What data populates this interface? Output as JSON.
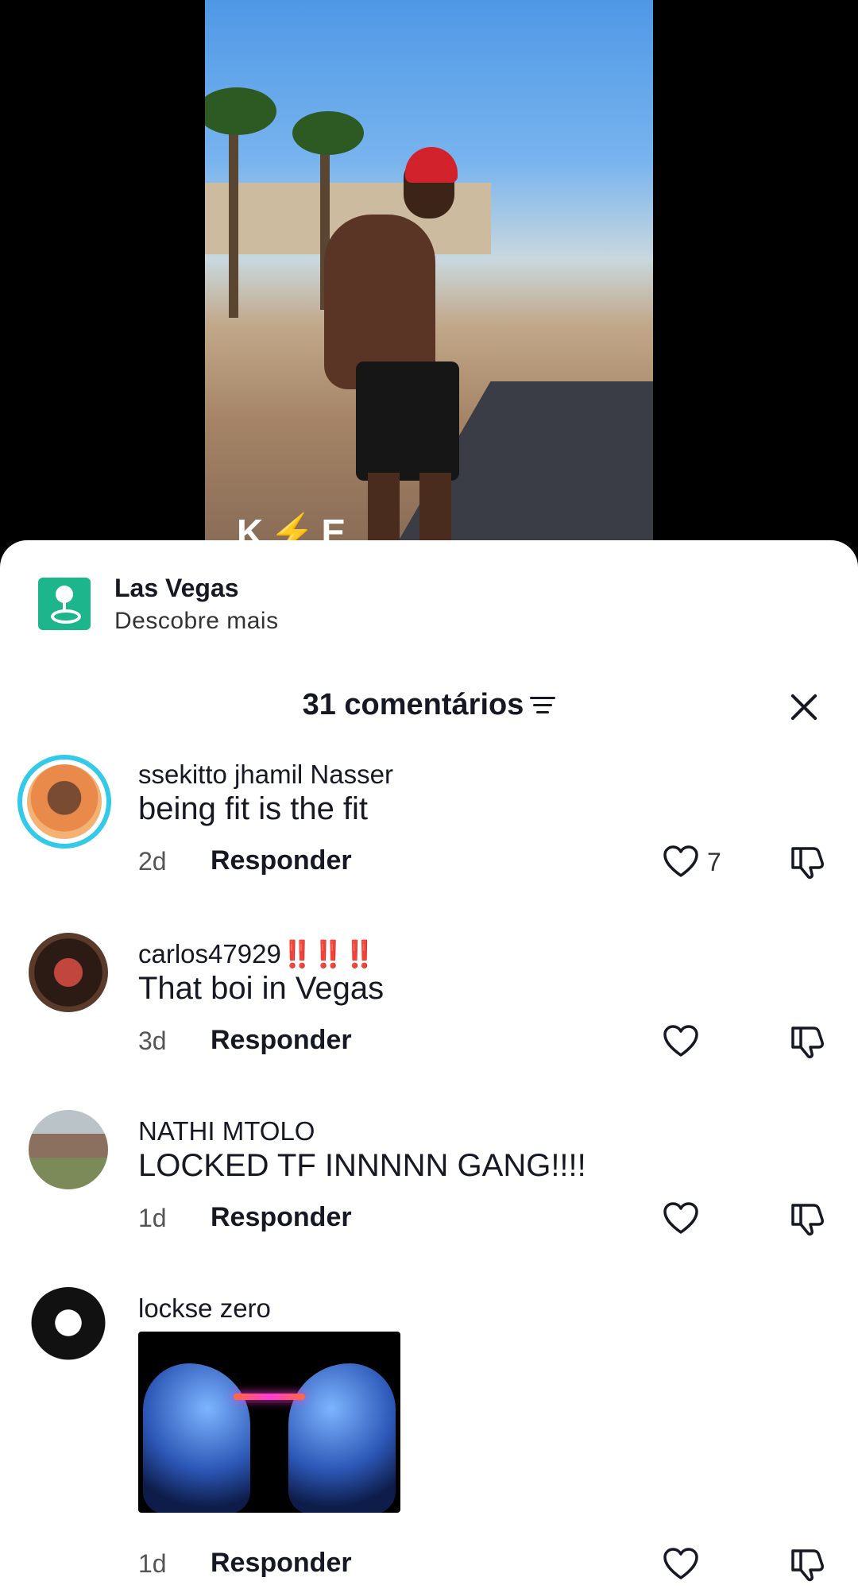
{
  "video": {
    "watermark": "K⚡E"
  },
  "location": {
    "title": "Las Vegas",
    "subtitle": "Descobre mais"
  },
  "comments_header": {
    "count_label": "31 comentários"
  },
  "comments": [
    {
      "username": "ssekitto jhamil Nasser",
      "text": "being fit is the fit",
      "time": "2d",
      "reply_label": "Responder",
      "likes": "7"
    },
    {
      "username": "carlos47929",
      "username_emoji": "‼️‼️‼️",
      "text": "That boi in Vegas",
      "time": "3d",
      "reply_label": "Responder",
      "likes": ""
    },
    {
      "username": "NATHI MTOLO",
      "text": "LOCKED TF INNNNN GANG!!!!",
      "time": "1d",
      "reply_label": "Responder",
      "likes": ""
    },
    {
      "username": "lockse zero",
      "text": "",
      "has_image": true,
      "time": "1d",
      "reply_label": "Responder",
      "likes": ""
    }
  ],
  "colors": {
    "accent_ring": "#33c9e8",
    "location_icon": "#1db68c"
  }
}
